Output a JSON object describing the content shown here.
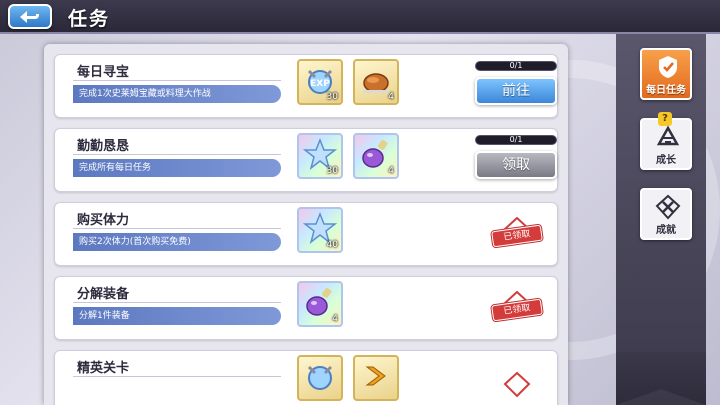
{
  "header": {
    "title": "任务"
  },
  "tabs": [
    {
      "label": "每日任务",
      "active": true,
      "icon": "daily-mission-icon"
    },
    {
      "label": "成长",
      "active": false,
      "icon": "growth-icon",
      "badge": "?"
    },
    {
      "label": "成就",
      "active": false,
      "icon": "achievement-icon"
    }
  ],
  "tasks": [
    {
      "title": "每日寻宝",
      "desc": "完成1次史莱姆宝藏或料理大作战",
      "rewards": [
        {
          "icon": "exp-potion-icon",
          "count": "30"
        },
        {
          "icon": "roast-chicken-icon",
          "count": "4"
        }
      ],
      "progress": {
        "text": "0/1",
        "fraction": 0
      },
      "action": {
        "type": "button",
        "style": "blue",
        "label": "前往"
      }
    },
    {
      "title": "勤勤恳恳",
      "desc": "完成所有每日任务",
      "rewards": [
        {
          "icon": "star-crystal-icon",
          "count": "30"
        },
        {
          "icon": "purple-potion-icon",
          "count": "4"
        }
      ],
      "progress": {
        "text": "0/1",
        "fraction": 0
      },
      "action": {
        "type": "button",
        "style": "gray",
        "label": "领取"
      }
    },
    {
      "title": "购买体力",
      "desc": "购买2次体力(首次购买免费)",
      "rewards": [
        {
          "icon": "star-crystal-icon",
          "count": "40"
        }
      ],
      "action": {
        "type": "stamp",
        "label": "已领取"
      }
    },
    {
      "title": "分解装备",
      "desc": "分解1件装备",
      "rewards": [
        {
          "icon": "purple-potion-icon",
          "count": "4"
        }
      ],
      "action": {
        "type": "stamp",
        "label": "已领取"
      }
    },
    {
      "title": "精英关卡",
      "desc": "",
      "rewards": [
        {
          "icon": "exp-potion-icon",
          "count": ""
        },
        {
          "icon": "chevron-item-icon",
          "count": ""
        }
      ],
      "action": {
        "type": "stamp",
        "label": ""
      }
    }
  ],
  "colors": {
    "accent_orange": "#e36a1e",
    "button_blue": "#3b86d8",
    "desc_blue": "#5c78c0",
    "stamp_red": "#d43b3b"
  }
}
